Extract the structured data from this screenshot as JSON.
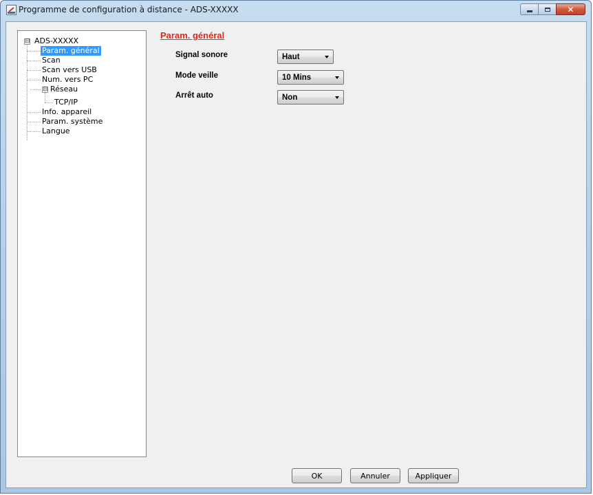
{
  "window": {
    "title": "Programme de configuration à distance - ADS-XXXXX",
    "icon": "remote-setup-app-icon",
    "controls": {
      "minimize": "minimize-icon",
      "maximize": "maximize-icon",
      "close": "close-icon",
      "close_glyph": "✕"
    }
  },
  "tree": {
    "root": {
      "label": "ADS-XXXXX",
      "expander": "⊟"
    },
    "items": [
      {
        "label": "Param. général",
        "selected": true
      },
      {
        "label": "Scan"
      },
      {
        "label": "Scan vers USB"
      },
      {
        "label": "Num. vers PC"
      },
      {
        "label": "Réseau",
        "expander": "⊟"
      },
      {
        "label": "TCP/IP"
      },
      {
        "label": "Info. appareil"
      },
      {
        "label": "Param. système"
      },
      {
        "label": "Langue"
      }
    ]
  },
  "main": {
    "section_title": "Param. général",
    "fields": [
      {
        "label": "Signal sonore",
        "value": "Haut"
      },
      {
        "label": "Mode veille",
        "value": "10 Mins"
      },
      {
        "label": "Arrêt auto",
        "value": "Non"
      }
    ]
  },
  "buttons": {
    "ok": "OK",
    "cancel": "Annuler",
    "apply": "Appliquer"
  },
  "colors": {
    "section_title": "#e0281b",
    "selection": "#3399ff"
  }
}
